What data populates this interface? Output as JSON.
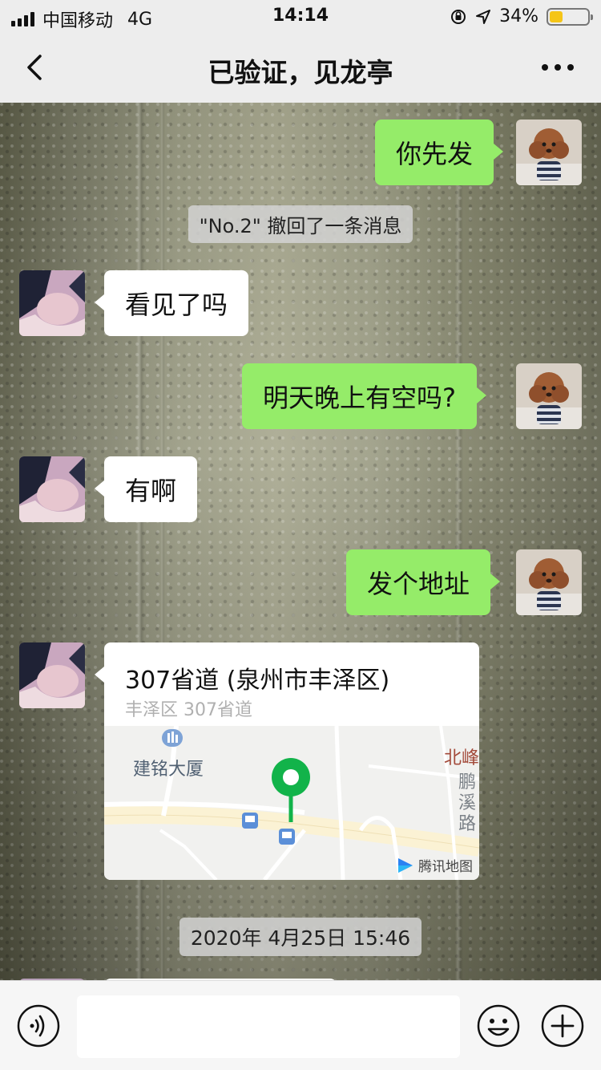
{
  "status_bar": {
    "carrier": "中国移动",
    "network": "4G",
    "time": "14:14",
    "battery": "34%",
    "battery_level": 0.34
  },
  "nav": {
    "title": "已验证，见龙亭",
    "back_icon": "chevron-left-icon",
    "more_icon": "more-dots-icon"
  },
  "messages": [
    {
      "side": "right",
      "type": "text",
      "text": "你先发"
    },
    {
      "type": "system",
      "text": "\"No.2\" 撤回了一条消息"
    },
    {
      "side": "left",
      "type": "text",
      "text": "看见了吗"
    },
    {
      "side": "right",
      "type": "text",
      "text": "明天晚上有空吗?"
    },
    {
      "side": "left",
      "type": "text",
      "text": "有啊"
    },
    {
      "side": "right",
      "type": "text",
      "text": "发个地址"
    },
    {
      "side": "left",
      "type": "location",
      "name": "307省道 (泉州市丰泽区)",
      "address": "丰泽区 307省道",
      "map_labels": {
        "building": "建铭大厦",
        "north": "北峰",
        "road": "鹏溪路",
        "provider": "腾讯地图"
      }
    },
    {
      "type": "timestamp",
      "text": "2020年 4月25日 15:46"
    }
  ],
  "input_bar": {
    "voice_icon": "voice-icon",
    "emoji_icon": "emoji-icon",
    "plus_icon": "plus-icon",
    "placeholder": ""
  },
  "colors": {
    "sent_bubble": "#95ec69",
    "received_bubble": "#ffffff",
    "bar_bg": "#ededed",
    "map_pin": "#12b34a"
  }
}
